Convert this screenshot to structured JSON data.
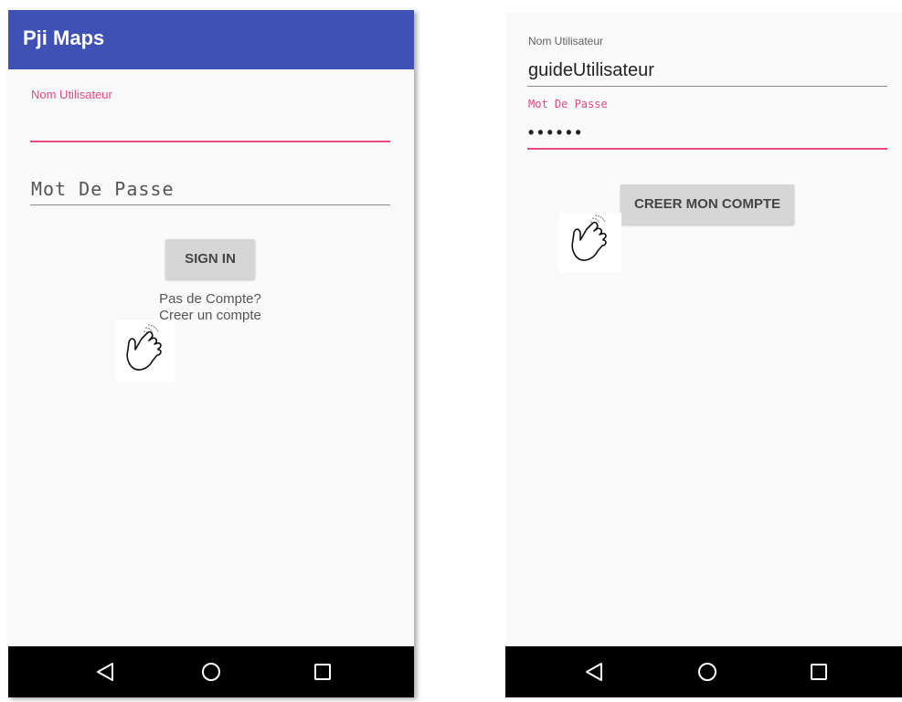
{
  "left_screen": {
    "app_title": "Pji Maps",
    "username_label": "Nom Utilisateur",
    "username_value": "",
    "password_hint": "Mot De Passe",
    "sign_in_label": "SIGN IN",
    "no_account_text": "Pas de Compte?",
    "create_account_link": "Creer un compte"
  },
  "right_screen": {
    "username_label": "Nom Utilisateur",
    "username_value": "guideUtilisateur",
    "password_label": "Mot De Passe",
    "password_value": "••••••",
    "create_account_button": "CREER MON COMPTE"
  },
  "navigation": {
    "icons": [
      "back-icon",
      "home-icon",
      "recents-icon"
    ]
  },
  "colors": {
    "app_bar": "#3f51b5",
    "accent": "#e8487b",
    "nav_bar": "#000000",
    "screen_bg": "#fafafa",
    "button_bg": "#d6d6d6"
  }
}
